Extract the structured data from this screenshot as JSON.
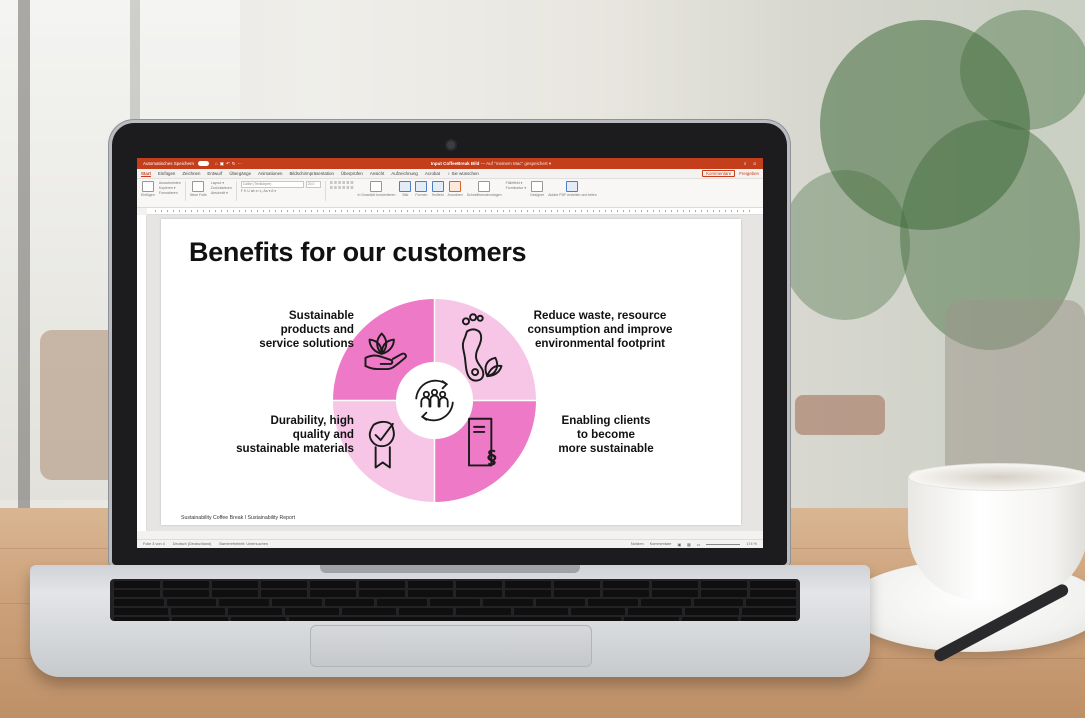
{
  "app": {
    "autosave_label": "Automatisches Speichern",
    "autosave_state": "Aus",
    "doc_title": "Input CoffeeBreak Bild",
    "doc_status": "— Auf \"meinem Mac\" gespeichert ▾",
    "tabs": [
      "Start",
      "Einfügen",
      "Zeichnen",
      "Entwurf",
      "Übergänge",
      "Animationen",
      "Bildschirmpräsentation",
      "Überprüfen",
      "Ansicht",
      "Aufzeichnung",
      "Acrobat",
      "♀ Sie wünschen"
    ],
    "active_tab": "Start",
    "comments_button": "Kommentare",
    "share_button": "Freigeben"
  },
  "ribbon": {
    "paste": "Einfügen",
    "clipboard_items": [
      "Ausschneiden",
      "Kopieren ▾",
      "Formatieren"
    ],
    "new_slide": "Neue Folie",
    "slide_items": [
      "Layout ▾",
      "Zurücksetzen",
      "Abschnitt ▾"
    ],
    "font_name": "Calibri (Textkörper)",
    "font_size": "20,0",
    "format_row1": "F K U ab x² x₂ Aa ▾ A ▾",
    "paragraph_row": "☰ ☰ ☰ ☰ ☰ ☰",
    "convert_smartart": "In SmartArt konvertieren",
    "picture": "Bild",
    "shapes": "Formen",
    "textbox": "Textfeld",
    "arrange": "Anordnen",
    "quick_styles": "Schnellformatvorlagen",
    "fill": "Fülleffekt ▾",
    "outline": "Formkontur ▾",
    "designer": "Designer",
    "adobe": "Adobe PDF erstellen und teilen"
  },
  "slide": {
    "title": "Benefits for our customers",
    "quadrants": {
      "top_left": [
        "Sustainable",
        "products and",
        "service solutions"
      ],
      "top_right": [
        "Reduce waste, resource",
        "consumption and improve",
        "environmental footprint"
      ],
      "bottom_left": [
        "Durability, high",
        "quality and",
        "sustainable materials"
      ],
      "bottom_right": [
        "Enabling clients",
        "to become",
        "more sustainable"
      ]
    },
    "footer": "Sustainability Coffee Break I Sustainability Report",
    "colors": {
      "dark_pink": "#ee7ac7",
      "light_pink": "#f7c6e6",
      "center": "#ffffff",
      "icon_stroke": "#1a1a1a"
    },
    "icons": [
      "hand-leaf-icon",
      "footprint-leaf-icon",
      "ribbon-check-icon",
      "document-paragraph-icon",
      "people-cycle-icon"
    ]
  },
  "statusbar": {
    "slide_counter": "Folie 3 von 4",
    "language": "Deutsch (Deutschland)",
    "accessibility": "Barrierefreiheit: Untersuchen",
    "notes": "Notizen",
    "comments": "Kommentare",
    "zoom": "174 %"
  }
}
